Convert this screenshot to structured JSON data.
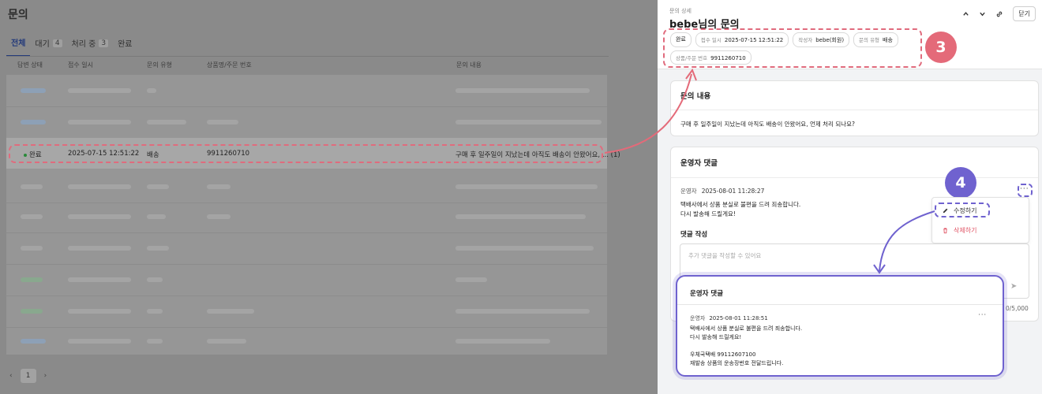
{
  "list": {
    "title": "문의",
    "tabs": [
      {
        "label": "전체",
        "count": ""
      },
      {
        "label": "대기",
        "count": "4"
      },
      {
        "label": "처리 중",
        "count": "3"
      },
      {
        "label": "완료",
        "count": ""
      }
    ],
    "columns": [
      "답변 상태",
      "접수 일시",
      "문의 유형",
      "상품명/주문 번호",
      "문의 내용"
    ],
    "highlight_row": {
      "status": "완료",
      "date": "2025-07-15 12:51:22",
      "type": "배송",
      "order": "9911260710",
      "content": "구매 후 일주일이 지났는데 아직도 배송이 안왔어요, ...",
      "reply_count": "(1)"
    },
    "pager": {
      "page": "1",
      "prev": "‹",
      "next": "›"
    }
  },
  "detail": {
    "breadcrumb": "문의 상세",
    "title": "bebe님의 문의",
    "close_label": "닫기",
    "chips": [
      {
        "key": "",
        "value": "완료"
      },
      {
        "key": "접수 일시",
        "value": "2025-07-15 12:51:22"
      },
      {
        "key": "작성자",
        "value": "bebe(회원)"
      },
      {
        "key": "문의 유형",
        "value": "배송"
      },
      {
        "key": "상품/주문 번호",
        "value": "9911260710"
      }
    ],
    "inquiry": {
      "title": "문의 내용",
      "text": "구매 후 일주일이 지났는데 아직도 배송이 안왔어요, 언제 처리 되나요?"
    },
    "comments": {
      "title": "운영자 댓글",
      "author": "운영자",
      "time": "2025-08-01 11:28:27",
      "line1": "택배사에서 상품 분실로 불편을 드려 죄송합니다.",
      "line2": "다시 발송해 드릴게요!",
      "more": "···",
      "menu_edit": "수정하기",
      "menu_delete": "삭제하기"
    },
    "reply": {
      "label": "댓글 작성",
      "placeholder": "추가 댓글을 작성할 수 있어요",
      "counter": "0/5,000"
    }
  },
  "popup": {
    "title": "운영자 댓글",
    "author": "운영자",
    "time": "2025-08-01 11:28:51",
    "line1": "택배사에서 상품 분실로 불편을 드려 죄송합니다.",
    "line2": "다시 발송해 드릴게요!",
    "line3": "우체국택배 99112607100",
    "line4": "재발송 상품의 운송장번호 전달드립니다.",
    "more": "···"
  },
  "annotations": {
    "step3": "3",
    "step4": "4"
  },
  "colors": {
    "accent_red": "#e46a79",
    "accent_purple": "#6f62cf",
    "navy": "#233a7a"
  }
}
